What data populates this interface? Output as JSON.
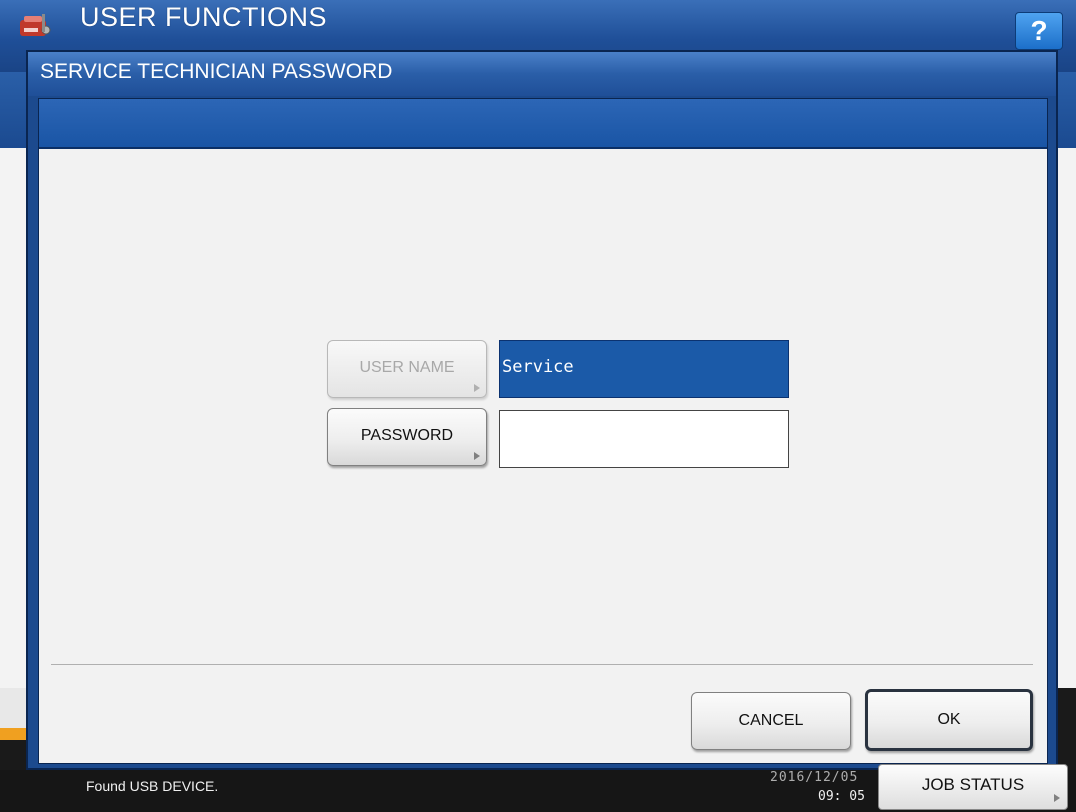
{
  "header": {
    "title": "USER FUNCTIONS",
    "help_label": "?",
    "app_icon": "printer-tools-icon"
  },
  "dialog": {
    "title": "SERVICE TECHNICIAN PASSWORD",
    "user_name_button": "USER NAME",
    "user_name_value": "Service",
    "password_button": "PASSWORD",
    "password_value": "",
    "cancel_button": "CANCEL",
    "ok_button": "OK"
  },
  "status_bar": {
    "message": "Found USB DEVICE.",
    "date": "2016/12/05",
    "time": "09: 05",
    "job_status_button": "JOB STATUS"
  },
  "colors": {
    "header_blue": "#1f4f98",
    "selected_field": "#1b5aa8",
    "panel_background": "#f2f2f2"
  }
}
